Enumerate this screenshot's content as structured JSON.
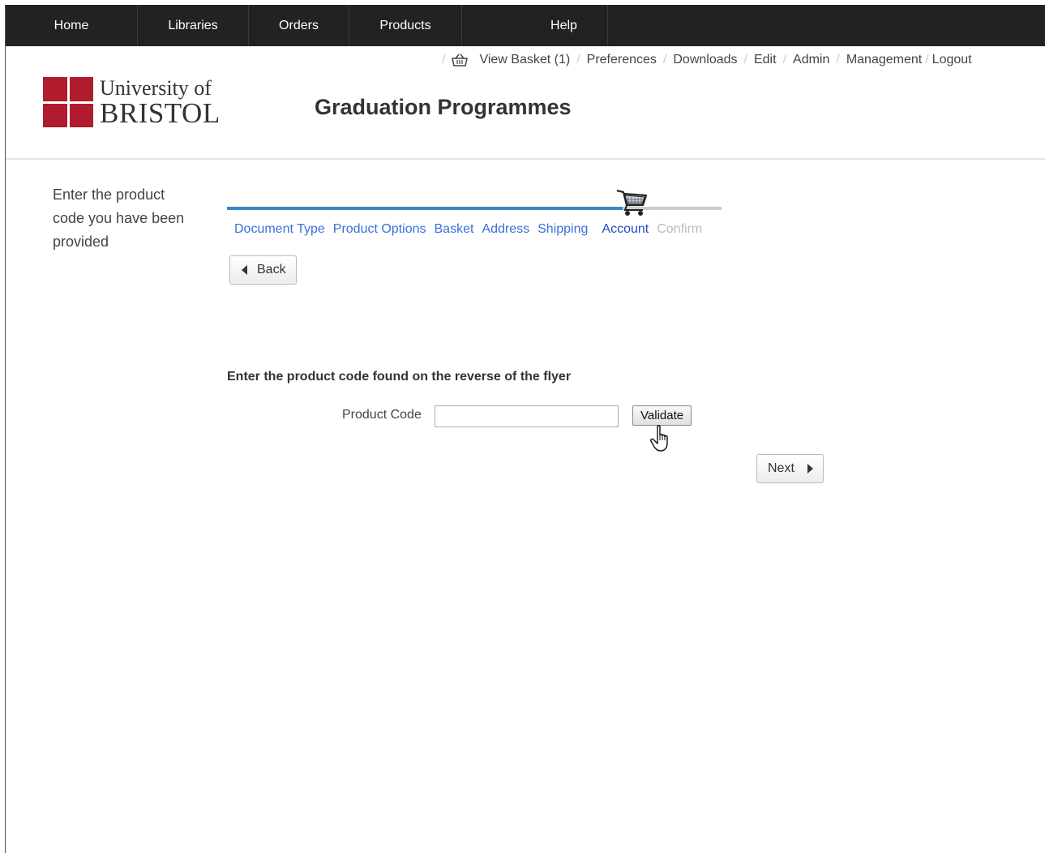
{
  "topnav": {
    "items": [
      {
        "label": "Home"
      },
      {
        "label": "Libraries"
      },
      {
        "label": "Orders"
      },
      {
        "label": "Products"
      },
      {
        "label": "Help"
      }
    ]
  },
  "header": {
    "logo_line1": "University of",
    "logo_line2": "BRISTOL",
    "title": "Graduation Programmes"
  },
  "utility": {
    "basket": "View Basket (1)",
    "preferences": "Preferences",
    "downloads": "Downloads",
    "edit": "Edit",
    "admin": "Admin",
    "management": "Management",
    "logout": "Logout"
  },
  "sidebar": {
    "instruction": "Enter the product code you have been provided"
  },
  "progress": {
    "fraction_complete": 0.8,
    "steps": [
      {
        "label": "Document Type",
        "state": "done"
      },
      {
        "label": "Product Options",
        "state": "done"
      },
      {
        "label": "Basket",
        "state": "done"
      },
      {
        "label": "Address",
        "state": "done"
      },
      {
        "label": "Shipping",
        "state": "done"
      },
      {
        "label": "Account",
        "state": "current"
      },
      {
        "label": "Confirm",
        "state": "disabled"
      }
    ]
  },
  "buttons": {
    "back": "Back",
    "validate": "Validate",
    "next": "Next"
  },
  "form": {
    "instruction": "Enter the product code found on the reverse of the flyer",
    "product_code_label": "Product Code",
    "product_code_value": ""
  },
  "colors": {
    "nav_bg": "#222222",
    "brand_red": "#b01c2e",
    "progress_fill": "#3a87c8",
    "link": "#3a6fd8"
  }
}
